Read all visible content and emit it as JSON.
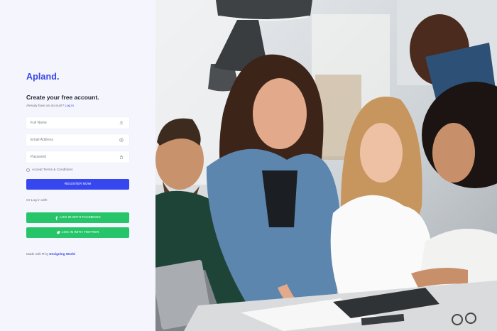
{
  "brand": {
    "logo": "Apland."
  },
  "form": {
    "title": "Create your free account.",
    "subtitle": "Already have an account?",
    "login_link": "Log in",
    "fields": [
      {
        "placeholder": "Full Name",
        "icon": "user-icon"
      },
      {
        "placeholder": "Email Address",
        "icon": "at-icon"
      },
      {
        "placeholder": "Password",
        "icon": "lock-icon"
      }
    ],
    "terms_label": "Accept Terms & Conditions",
    "register_label": "REGISTER NOW",
    "or_label": "Or Log in with",
    "facebook_label": "LOG IN WITH FACEBOOK",
    "twitter_label": "LOG IN WITH TWITTER"
  },
  "footer": {
    "made_with": "Made with",
    "heart": "♥",
    "by": "by",
    "credit": "Designing World"
  },
  "colors": {
    "accent": "#3747f0",
    "social": "#27c56a",
    "panel_bg": "#f4f5fd"
  }
}
